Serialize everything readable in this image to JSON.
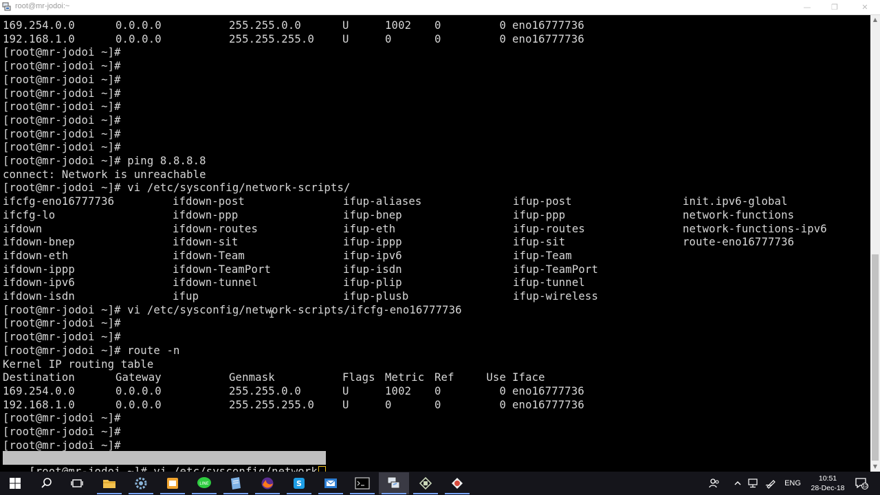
{
  "window": {
    "title": "root@mr-jodoi:~"
  },
  "terminal_lines": [
    {
      "cells": [
        "169.254.0.0",
        "0.0.0.0",
        "255.255.0.0",
        "U",
        "1002",
        "0",
        "0",
        "eno16777736"
      ]
    },
    {
      "cells": [
        "192.168.1.0",
        "0.0.0.0",
        "255.255.255.0",
        "U",
        "0",
        "0",
        "0",
        "eno16777736"
      ]
    },
    {
      "text": "[root@mr-jodoi ~]#"
    },
    {
      "text": "[root@mr-jodoi ~]#"
    },
    {
      "text": "[root@mr-jodoi ~]#"
    },
    {
      "text": "[root@mr-jodoi ~]#"
    },
    {
      "text": "[root@mr-jodoi ~]#"
    },
    {
      "text": "[root@mr-jodoi ~]#"
    },
    {
      "text": "[root@mr-jodoi ~]#"
    },
    {
      "text": "[root@mr-jodoi ~]#"
    },
    {
      "text": "[root@mr-jodoi ~]# ping 8.8.8.8"
    },
    {
      "text": "connect: Network is unreachable"
    },
    {
      "text": "[root@mr-jodoi ~]# vi /etc/sysconfig/network-scripts/"
    },
    {
      "cols": [
        "ifcfg-eno16777736",
        "ifdown-post",
        "ifup-aliases",
        "ifup-post",
        "init.ipv6-global"
      ]
    },
    {
      "cols": [
        "ifcfg-lo",
        "ifdown-ppp",
        "ifup-bnep",
        "ifup-ppp",
        "network-functions"
      ]
    },
    {
      "cols": [
        "ifdown",
        "ifdown-routes",
        "ifup-eth",
        "ifup-routes",
        "network-functions-ipv6"
      ]
    },
    {
      "cols": [
        "ifdown-bnep",
        "ifdown-sit",
        "ifup-ippp",
        "ifup-sit",
        "route-eno16777736"
      ]
    },
    {
      "cols": [
        "ifdown-eth",
        "ifdown-Team",
        "ifup-ipv6",
        "ifup-Team",
        ""
      ]
    },
    {
      "cols": [
        "ifdown-ippp",
        "ifdown-TeamPort",
        "ifup-isdn",
        "ifup-TeamPort",
        ""
      ]
    },
    {
      "cols": [
        "ifdown-ipv6",
        "ifdown-tunnel",
        "ifup-plip",
        "ifup-tunnel",
        ""
      ]
    },
    {
      "cols": [
        "ifdown-isdn",
        "ifup",
        "ifup-plusb",
        "ifup-wireless",
        ""
      ]
    },
    {
      "text": "[root@mr-jodoi ~]# vi /etc/sysconfig/network-scripts/ifcfg-eno16777736"
    },
    {
      "text": "[root@mr-jodoi ~]#"
    },
    {
      "text": "[root@mr-jodoi ~]#"
    },
    {
      "text": "[root@mr-jodoi ~]# route -n"
    },
    {
      "text": "Kernel IP routing table"
    },
    {
      "cells": [
        "Destination",
        "Gateway",
        "Genmask",
        "Flags",
        "Metric",
        "Ref",
        "Use",
        "Iface"
      ]
    },
    {
      "cells": [
        "169.254.0.0",
        "0.0.0.0",
        "255.255.0.0",
        "U",
        "1002",
        "0",
        "0",
        "eno16777736"
      ]
    },
    {
      "cells": [
        "192.168.1.0",
        "0.0.0.0",
        "255.255.255.0",
        "U",
        "0",
        "0",
        "0",
        "eno16777736"
      ]
    },
    {
      "text": "[root@mr-jodoi ~]#"
    },
    {
      "text": "[root@mr-jodoi ~]#"
    },
    {
      "text": "[root@mr-jodoi ~]#"
    }
  ],
  "command_line": {
    "prompt_a": "[root@mr-jodoi ~",
    "prompt_b": "]# ",
    "input": "vi /etc/sysconfig/network"
  },
  "taskbar": {
    "language": "ENG",
    "time": "10:51",
    "date": "28-Dec-18",
    "notification_count": "12",
    "apps": [
      {
        "name": "start-icon",
        "color": "#ffffff"
      },
      {
        "name": "search-icon",
        "color": "#ffffff"
      },
      {
        "name": "task-view-icon",
        "color": "#ffffff"
      },
      {
        "name": "file-explorer-icon",
        "color": "#f2c14e"
      },
      {
        "name": "settings-app-icon",
        "color": "#8ab4d8"
      },
      {
        "name": "outlook-icon",
        "color": "#f0a430"
      },
      {
        "name": "line-app-icon",
        "color": "#2ecc40"
      },
      {
        "name": "notepad-icon",
        "color": "#7fb2e5"
      },
      {
        "name": "firefox-icon",
        "color": "#ff7a1a"
      },
      {
        "name": "skype-icon",
        "color": "#1e9ee6"
      },
      {
        "name": "outlook-mail-icon",
        "color": "#2d7dd2"
      },
      {
        "name": "cmd-terminal-icon",
        "color": "#cfcfcf"
      },
      {
        "name": "putty-icon",
        "color": "#6fa3e0"
      },
      {
        "name": "vm-app-icon",
        "color": "#c9d6b8"
      },
      {
        "name": "vmware-icon",
        "color": "#d84a3c"
      }
    ]
  }
}
